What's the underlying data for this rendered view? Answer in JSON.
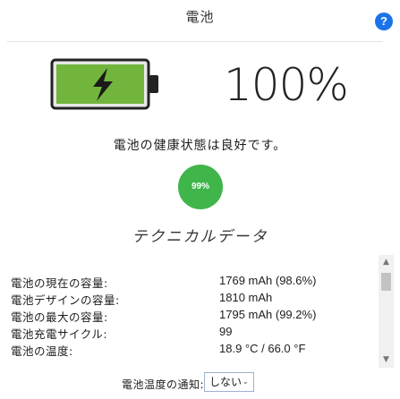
{
  "window": {
    "title": "電池"
  },
  "battery": {
    "percent_text": "100%",
    "level": 1.0,
    "fill_color": "#72b53c"
  },
  "status": {
    "text": "電池の健康状態は良好です。"
  },
  "health": {
    "value_text": "99%",
    "color": "#3fb54a"
  },
  "section": {
    "title": "テクニカルデータ"
  },
  "specs": [
    {
      "label": "電池の現在の容量:",
      "value": "1769 mAh (98.6%)"
    },
    {
      "label": "電池デザインの容量:",
      "value": "1810 mAh"
    },
    {
      "label": "電池の最大の容量:",
      "value": "1795 mAh (99.2%)"
    },
    {
      "label": "電池充電サイクル:",
      "value": "99"
    },
    {
      "label": "電池の温度:",
      "value": "18.9 °C / 66.0 °F"
    }
  ],
  "footer": {
    "label": "電池温度の通知:",
    "dropdown_value": "しない"
  },
  "icons": {
    "help": "?",
    "scroll_up": "▲",
    "scroll_down": "▼",
    "chevron": "⌄"
  }
}
